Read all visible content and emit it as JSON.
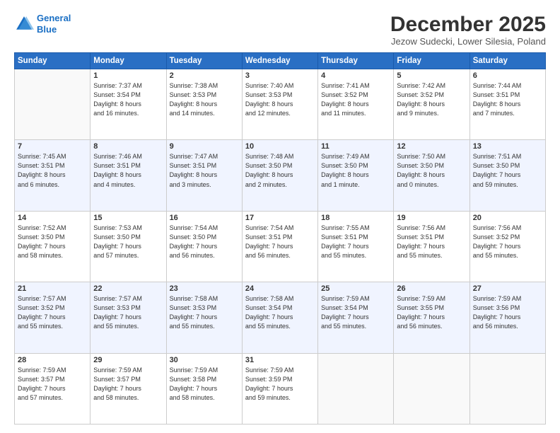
{
  "header": {
    "logo_line1": "General",
    "logo_line2": "Blue",
    "month": "December 2025",
    "location": "Jezow Sudecki, Lower Silesia, Poland"
  },
  "days_of_week": [
    "Sunday",
    "Monday",
    "Tuesday",
    "Wednesday",
    "Thursday",
    "Friday",
    "Saturday"
  ],
  "weeks": [
    [
      {
        "day": "",
        "info": ""
      },
      {
        "day": "1",
        "info": "Sunrise: 7:37 AM\nSunset: 3:54 PM\nDaylight: 8 hours\nand 16 minutes."
      },
      {
        "day": "2",
        "info": "Sunrise: 7:38 AM\nSunset: 3:53 PM\nDaylight: 8 hours\nand 14 minutes."
      },
      {
        "day": "3",
        "info": "Sunrise: 7:40 AM\nSunset: 3:53 PM\nDaylight: 8 hours\nand 12 minutes."
      },
      {
        "day": "4",
        "info": "Sunrise: 7:41 AM\nSunset: 3:52 PM\nDaylight: 8 hours\nand 11 minutes."
      },
      {
        "day": "5",
        "info": "Sunrise: 7:42 AM\nSunset: 3:52 PM\nDaylight: 8 hours\nand 9 minutes."
      },
      {
        "day": "6",
        "info": "Sunrise: 7:44 AM\nSunset: 3:51 PM\nDaylight: 8 hours\nand 7 minutes."
      }
    ],
    [
      {
        "day": "7",
        "info": "Sunrise: 7:45 AM\nSunset: 3:51 PM\nDaylight: 8 hours\nand 6 minutes."
      },
      {
        "day": "8",
        "info": "Sunrise: 7:46 AM\nSunset: 3:51 PM\nDaylight: 8 hours\nand 4 minutes."
      },
      {
        "day": "9",
        "info": "Sunrise: 7:47 AM\nSunset: 3:51 PM\nDaylight: 8 hours\nand 3 minutes."
      },
      {
        "day": "10",
        "info": "Sunrise: 7:48 AM\nSunset: 3:50 PM\nDaylight: 8 hours\nand 2 minutes."
      },
      {
        "day": "11",
        "info": "Sunrise: 7:49 AM\nSunset: 3:50 PM\nDaylight: 8 hours\nand 1 minute."
      },
      {
        "day": "12",
        "info": "Sunrise: 7:50 AM\nSunset: 3:50 PM\nDaylight: 8 hours\nand 0 minutes."
      },
      {
        "day": "13",
        "info": "Sunrise: 7:51 AM\nSunset: 3:50 PM\nDaylight: 7 hours\nand 59 minutes."
      }
    ],
    [
      {
        "day": "14",
        "info": "Sunrise: 7:52 AM\nSunset: 3:50 PM\nDaylight: 7 hours\nand 58 minutes."
      },
      {
        "day": "15",
        "info": "Sunrise: 7:53 AM\nSunset: 3:50 PM\nDaylight: 7 hours\nand 57 minutes."
      },
      {
        "day": "16",
        "info": "Sunrise: 7:54 AM\nSunset: 3:50 PM\nDaylight: 7 hours\nand 56 minutes."
      },
      {
        "day": "17",
        "info": "Sunrise: 7:54 AM\nSunset: 3:51 PM\nDaylight: 7 hours\nand 56 minutes."
      },
      {
        "day": "18",
        "info": "Sunrise: 7:55 AM\nSunset: 3:51 PM\nDaylight: 7 hours\nand 55 minutes."
      },
      {
        "day": "19",
        "info": "Sunrise: 7:56 AM\nSunset: 3:51 PM\nDaylight: 7 hours\nand 55 minutes."
      },
      {
        "day": "20",
        "info": "Sunrise: 7:56 AM\nSunset: 3:52 PM\nDaylight: 7 hours\nand 55 minutes."
      }
    ],
    [
      {
        "day": "21",
        "info": "Sunrise: 7:57 AM\nSunset: 3:52 PM\nDaylight: 7 hours\nand 55 minutes."
      },
      {
        "day": "22",
        "info": "Sunrise: 7:57 AM\nSunset: 3:53 PM\nDaylight: 7 hours\nand 55 minutes."
      },
      {
        "day": "23",
        "info": "Sunrise: 7:58 AM\nSunset: 3:53 PM\nDaylight: 7 hours\nand 55 minutes."
      },
      {
        "day": "24",
        "info": "Sunrise: 7:58 AM\nSunset: 3:54 PM\nDaylight: 7 hours\nand 55 minutes."
      },
      {
        "day": "25",
        "info": "Sunrise: 7:59 AM\nSunset: 3:54 PM\nDaylight: 7 hours\nand 55 minutes."
      },
      {
        "day": "26",
        "info": "Sunrise: 7:59 AM\nSunset: 3:55 PM\nDaylight: 7 hours\nand 56 minutes."
      },
      {
        "day": "27",
        "info": "Sunrise: 7:59 AM\nSunset: 3:56 PM\nDaylight: 7 hours\nand 56 minutes."
      }
    ],
    [
      {
        "day": "28",
        "info": "Sunrise: 7:59 AM\nSunset: 3:57 PM\nDaylight: 7 hours\nand 57 minutes."
      },
      {
        "day": "29",
        "info": "Sunrise: 7:59 AM\nSunset: 3:57 PM\nDaylight: 7 hours\nand 58 minutes."
      },
      {
        "day": "30",
        "info": "Sunrise: 7:59 AM\nSunset: 3:58 PM\nDaylight: 7 hours\nand 58 minutes."
      },
      {
        "day": "31",
        "info": "Sunrise: 7:59 AM\nSunset: 3:59 PM\nDaylight: 7 hours\nand 59 minutes."
      },
      {
        "day": "",
        "info": ""
      },
      {
        "day": "",
        "info": ""
      },
      {
        "day": "",
        "info": ""
      }
    ]
  ]
}
